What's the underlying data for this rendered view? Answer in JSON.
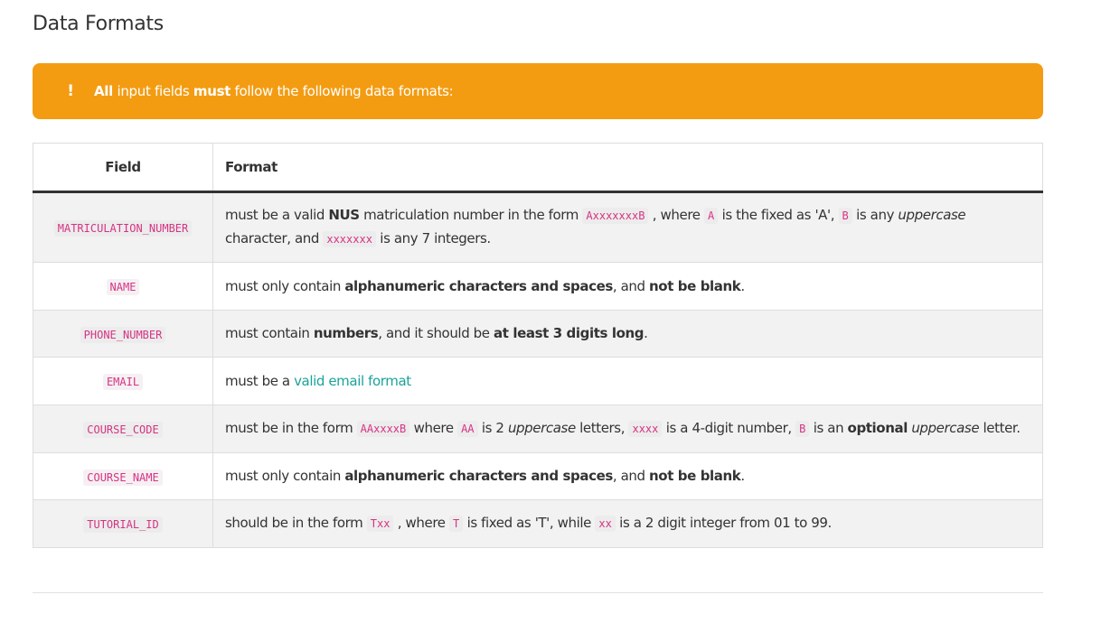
{
  "page_title": "Data Formats",
  "callout": {
    "icon": "!",
    "parts": [
      "All",
      " input fields ",
      "must",
      " follow the following data formats:"
    ],
    "color": "#f39c12"
  },
  "table": {
    "headers": {
      "field": "Field",
      "format": "Format"
    },
    "rows": {
      "matriculation_number": {
        "field": "MATRICULATION_NUMBER",
        "t1": "must be a valid ",
        "t2": "NUS",
        "t3": " matriculation number in the form ",
        "c1": "AxxxxxxxB",
        "t4": " , where ",
        "c2": "A",
        "t5": " is the fixed as 'A', ",
        "c3": "B",
        "t6": " is any ",
        "t7": "uppercase",
        "t8": " character, and ",
        "c4": "xxxxxxx",
        "t9": " is any 7 integers."
      },
      "name": {
        "field": "NAME",
        "t1": "must only contain ",
        "t2": "alphanumeric characters and spaces",
        "t3": ", and ",
        "t4": "not be blank",
        "t5": "."
      },
      "phone_number": {
        "field": "PHONE_NUMBER",
        "t1": "must contain ",
        "t2": "numbers",
        "t3": ", and it should be ",
        "t4": "at least 3 digits long",
        "t5": "."
      },
      "email": {
        "field": "EMAIL",
        "t1": "must be a ",
        "link": "valid email format"
      },
      "course_code": {
        "field": "COURSE_CODE",
        "t1": "must be in the form ",
        "c1": "AAxxxxB",
        "t2": " where ",
        "c2": "AA",
        "t3": " is 2 ",
        "t4": "uppercase",
        "t5": " letters, ",
        "c3": "xxxx",
        "t6": " is a 4-digit number, ",
        "c4": "B",
        "t7": " is an ",
        "t8": "optional",
        "t9": " ",
        "t10": "uppercase",
        "t11": " letter."
      },
      "course_name": {
        "field": "COURSE_NAME",
        "t1": "must only contain ",
        "t2": "alphanumeric characters and spaces",
        "t3": ", and ",
        "t4": "not be blank",
        "t5": "."
      },
      "tutorial_id": {
        "field": "TUTORIAL_ID",
        "t1": "should be in the form ",
        "c1": "Txx",
        "t2": " , where ",
        "c2": "T",
        "t3": " is fixed as 'T', while ",
        "c3": "xx",
        "t4": " is a 2 digit integer from 01 to 99."
      }
    }
  },
  "colors": {
    "accent": "#f39c12",
    "code": "#d63384",
    "link": "#1aa39a"
  }
}
